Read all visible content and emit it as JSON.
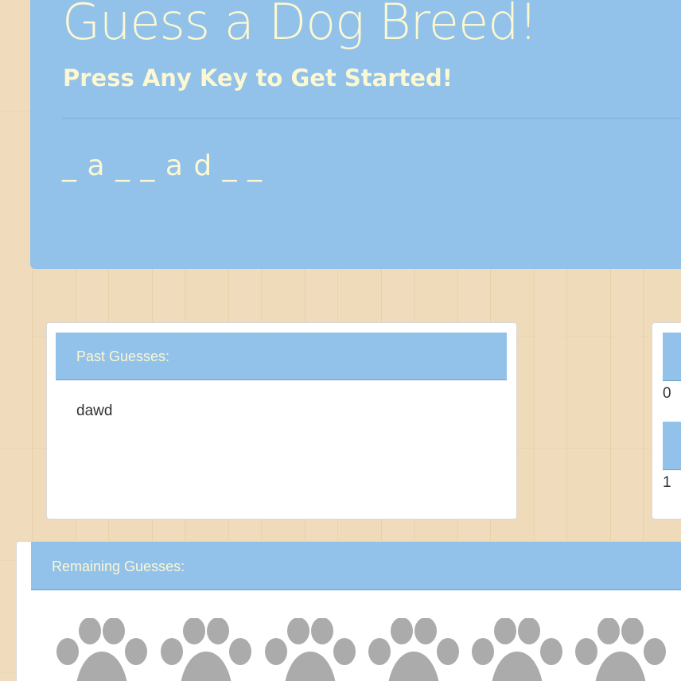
{
  "header": {
    "title": "Guess a Dog Breed!",
    "subtitle": "Press Any Key to Get Started!",
    "word_display": "_ a _ _ a d _ _"
  },
  "past_guesses": {
    "label": "Past Guesses:",
    "value": "dawd"
  },
  "stats": {
    "first_value": "0",
    "second_value": "1"
  },
  "remaining_guesses": {
    "label": "Remaining Guesses:",
    "paw_icon": "paw-print-icon",
    "visible_paw_count": 6
  },
  "colors": {
    "panel_blue": "#92c1e9",
    "title_cream": "#fbf8d2",
    "paw_gray": "#ababab",
    "wood_background": "#eed8b6"
  }
}
